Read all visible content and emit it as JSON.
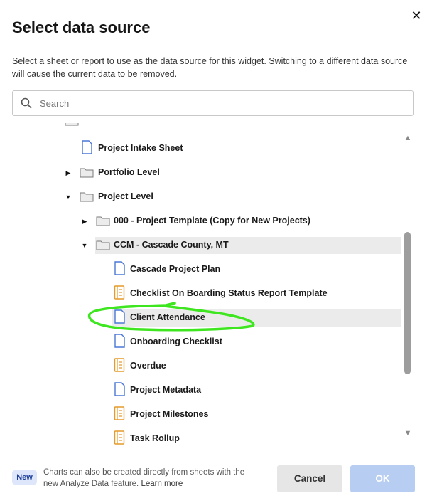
{
  "dialog": {
    "title": "Select data source",
    "description": "Select a sheet or report to use as the data source for this widget. Switching to a different data source will cause the current data to be removed."
  },
  "search": {
    "placeholder": "Search",
    "value": ""
  },
  "tree": {
    "items": [
      {
        "label": "",
        "type": "folder",
        "expanded": null
      },
      {
        "label": "Project Intake Sheet",
        "type": "sheet"
      },
      {
        "label": "Portfolio Level",
        "type": "folder",
        "expanded": false
      },
      {
        "label": "Project Level",
        "type": "folder",
        "expanded": true
      },
      {
        "label": "000 - Project Template (Copy for New Projects)",
        "type": "folder",
        "expanded": false
      },
      {
        "label": "CCM - Cascade County, MT",
        "type": "folder",
        "expanded": true
      },
      {
        "label": "Cascade Project Plan",
        "type": "sheet"
      },
      {
        "label": "Checklist On Boarding Status Report Template",
        "type": "report"
      },
      {
        "label": "Client Attendance",
        "type": "sheet",
        "highlighted": true
      },
      {
        "label": "Onboarding Checklist",
        "type": "sheet"
      },
      {
        "label": "Overdue",
        "type": "report"
      },
      {
        "label": "Project Metadata",
        "type": "sheet"
      },
      {
        "label": "Project Milestones",
        "type": "report"
      },
      {
        "label": "Task Rollup",
        "type": "report"
      }
    ]
  },
  "footer": {
    "badge": "New",
    "note_text": "Charts can also be created directly from sheets with the new Analyze Data feature.",
    "learn_more": "Learn more",
    "cancel_label": "Cancel",
    "ok_label": "OK"
  },
  "colors": {
    "sheet_icon": "#4b78d6",
    "report_icon": "#e59a2a",
    "folder_icon": "#7a7a7a",
    "annotation": "#3ee61f",
    "ok_disabled": "#b7cdf1"
  }
}
